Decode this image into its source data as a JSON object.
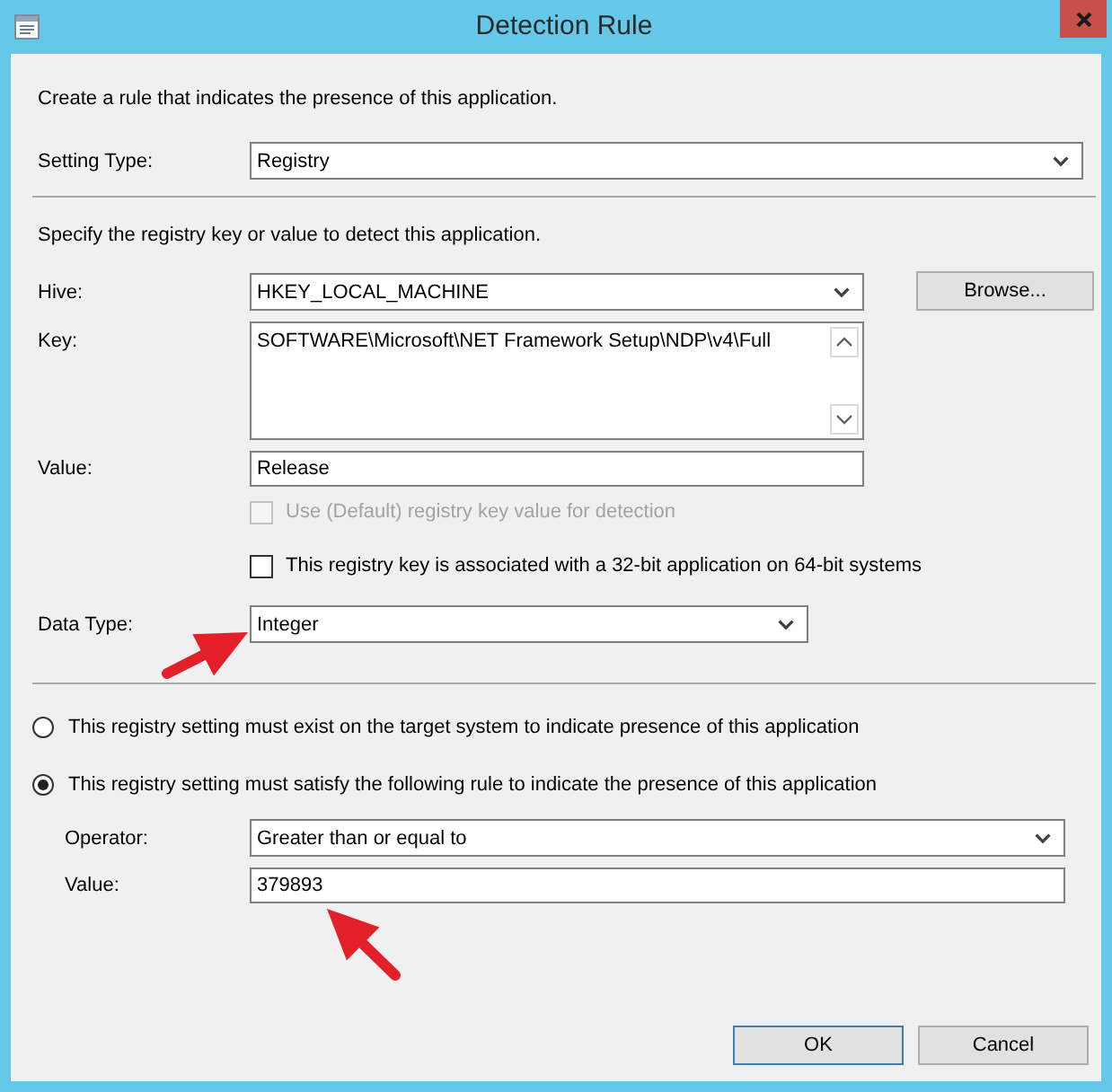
{
  "window": {
    "title": "Detection Rule"
  },
  "intro": "Create a rule that indicates the presence of this application.",
  "setting_type": {
    "label": "Setting Type:",
    "value": "Registry"
  },
  "registry": {
    "instruction": "Specify the registry key or value to detect this application.",
    "hive": {
      "label": "Hive:",
      "value": "HKEY_LOCAL_MACHINE"
    },
    "browse_button": "Browse...",
    "key": {
      "label": "Key:",
      "value": "SOFTWARE\\Microsoft\\NET Framework Setup\\NDP\\v4\\Full"
    },
    "value": {
      "label": "Value:",
      "value": "Release"
    },
    "checkboxes": [
      {
        "label": "Use (Default) registry key value for detection",
        "checked": false,
        "disabled": true
      },
      {
        "label": "This registry key is associated with a 32-bit application on 64-bit systems",
        "checked": false,
        "disabled": false
      }
    ],
    "data_type": {
      "label": "Data Type:",
      "value": "Integer"
    }
  },
  "options": [
    {
      "label": "This registry setting must exist on the target system to indicate presence of this application",
      "selected": false
    },
    {
      "label": "This registry setting must satisfy the following rule to indicate the presence of this application",
      "selected": true
    }
  ],
  "rule": {
    "operator": {
      "label": "Operator:",
      "value": "Greater than or equal to"
    },
    "value": {
      "label": "Value:",
      "value": "379893"
    }
  },
  "buttons": [
    {
      "label": "OK",
      "default": true
    },
    {
      "label": "Cancel",
      "default": false
    }
  ]
}
